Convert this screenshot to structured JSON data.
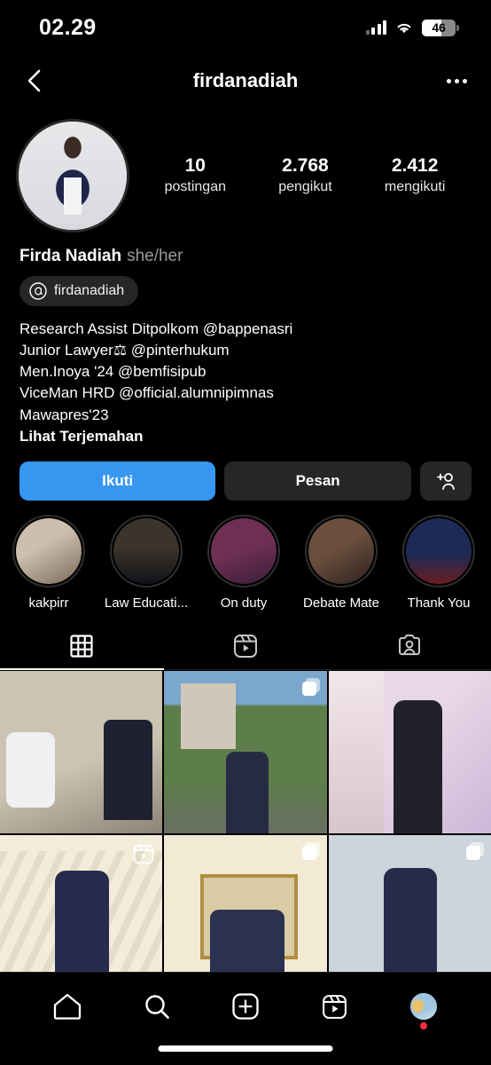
{
  "statusbar": {
    "time": "02.29",
    "battery_percent": "46",
    "icons": [
      "cellular-signal-icon",
      "wifi-icon",
      "battery-icon"
    ]
  },
  "navbar": {
    "back_icon": "chevron-left-icon",
    "title": "firdanadiah",
    "more_icon": "more-options-icon"
  },
  "profile": {
    "avatar_name": "profile-avatar",
    "display_name": "Firda Nadiah",
    "pronouns": "she/her",
    "threads_handle": "firdanadiah",
    "stats": [
      {
        "value": "10",
        "label": "postingan"
      },
      {
        "value": "2.768",
        "label": "pengikut"
      },
      {
        "value": "2.412",
        "label": "mengikuti"
      }
    ],
    "bio": [
      "Research Assist Ditpolkom @bappenasri",
      "Junior Lawyer⚖ @pinterhukum",
      "Men.Inoya '24 @bemfisipub",
      "ViceMan HRD @official.alumnipimnas",
      "Mawapres'23"
    ],
    "translate_label": "Lihat Terjemahan"
  },
  "actions": {
    "follow_label": "Ikuti",
    "message_label": "Pesan",
    "add_person_icon": "add-person-icon",
    "follow_color": "#3797f0"
  },
  "highlights": [
    {
      "label": "kakpirr",
      "art": "hla1"
    },
    {
      "label": "Law Educati...",
      "art": "hla2"
    },
    {
      "label": "On duty",
      "art": "hla3"
    },
    {
      "label": "Debate Mate",
      "art": "hla4"
    },
    {
      "label": "Thank You",
      "art": "hla5"
    }
  ],
  "tabs": [
    {
      "name": "grid-tab",
      "icon": "grid-icon",
      "active": true
    },
    {
      "name": "reels-tab",
      "icon": "reels-icon",
      "active": false
    },
    {
      "name": "tagged-tab",
      "icon": "tagged-icon",
      "active": false
    }
  ],
  "grid": [
    {
      "art": "a1",
      "badge": "none"
    },
    {
      "art": "a2",
      "badge": "carousel"
    },
    {
      "art": "a3",
      "badge": "none"
    },
    {
      "art": "a4",
      "badge": "reel"
    },
    {
      "art": "a5",
      "badge": "carousel"
    },
    {
      "art": "a6",
      "badge": "carousel"
    }
  ],
  "bottom_nav": [
    {
      "name": "nav-home",
      "icon": "home-icon"
    },
    {
      "name": "nav-search",
      "icon": "search-icon"
    },
    {
      "name": "nav-create",
      "icon": "plus-square-icon"
    },
    {
      "name": "nav-reels",
      "icon": "reels-icon"
    },
    {
      "name": "nav-profile",
      "icon": "profile-avatar-icon"
    }
  ]
}
